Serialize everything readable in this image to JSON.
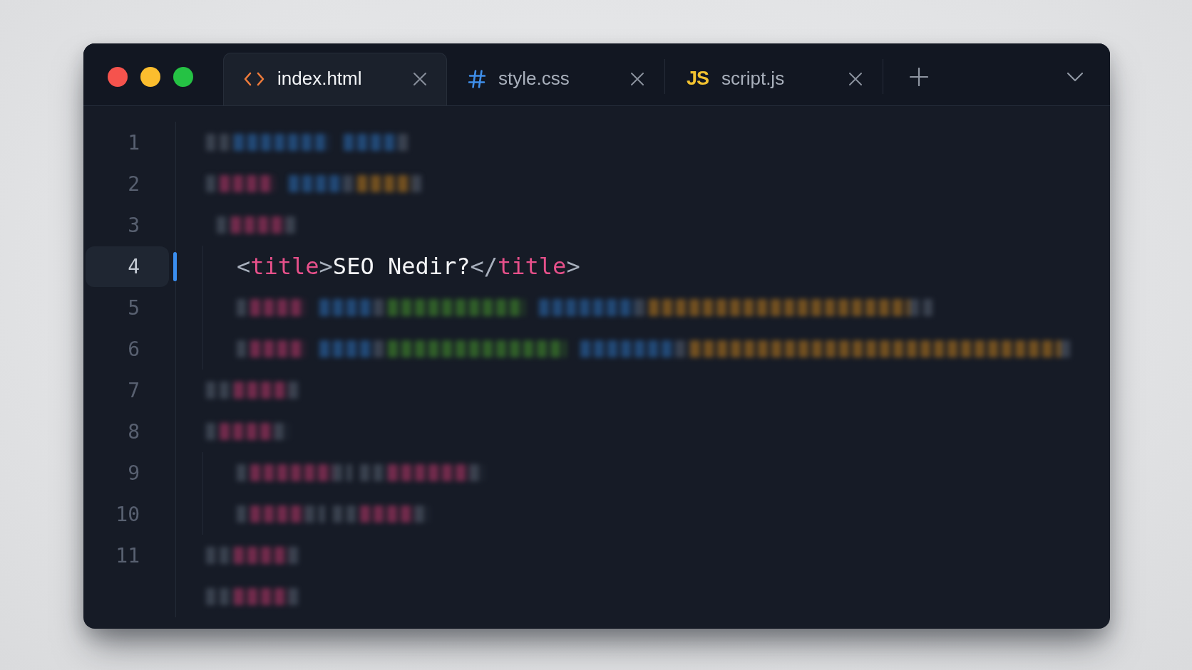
{
  "tabs": [
    {
      "label": "index.html",
      "kind": "html",
      "selected": true
    },
    {
      "label": "style.css",
      "kind": "css",
      "selected": false
    },
    {
      "label": "script.js",
      "kind": "js",
      "icon_text": "JS",
      "selected": false
    }
  ],
  "editor": {
    "lines": [
      {
        "number": "1",
        "kind": "blurred",
        "active": false
      },
      {
        "number": "2",
        "kind": "blurred",
        "active": false
      },
      {
        "number": "3",
        "kind": "blurred",
        "active": false,
        "children": [
          {
            "number": "4",
            "kind": "code",
            "active": true,
            "tokens": [
              {
                "kind": "punct",
                "text": "<"
              },
              {
                "kind": "tag",
                "text": "title"
              },
              {
                "kind": "punct",
                "text": ">"
              },
              {
                "kind": "text",
                "text": "SEO Nedir?"
              },
              {
                "kind": "punct",
                "text": "</"
              },
              {
                "kind": "tag",
                "text": "title"
              },
              {
                "kind": "punct",
                "text": ">"
              }
            ]
          },
          {
            "number": "5",
            "kind": "blurred",
            "active": false
          },
          {
            "number": "6",
            "kind": "blurred",
            "active": false
          }
        ]
      },
      {
        "number": "7",
        "kind": "blurred",
        "active": false
      },
      {
        "number": "8",
        "kind": "blurred",
        "active": false,
        "children": [
          {
            "number": "9",
            "kind": "blurred",
            "active": false
          },
          {
            "number": "10",
            "kind": "blurred",
            "active": false
          }
        ]
      },
      {
        "number": "11",
        "kind": "blurred",
        "active": false
      },
      {
        "kind": "blurred",
        "active": false
      }
    ]
  }
}
